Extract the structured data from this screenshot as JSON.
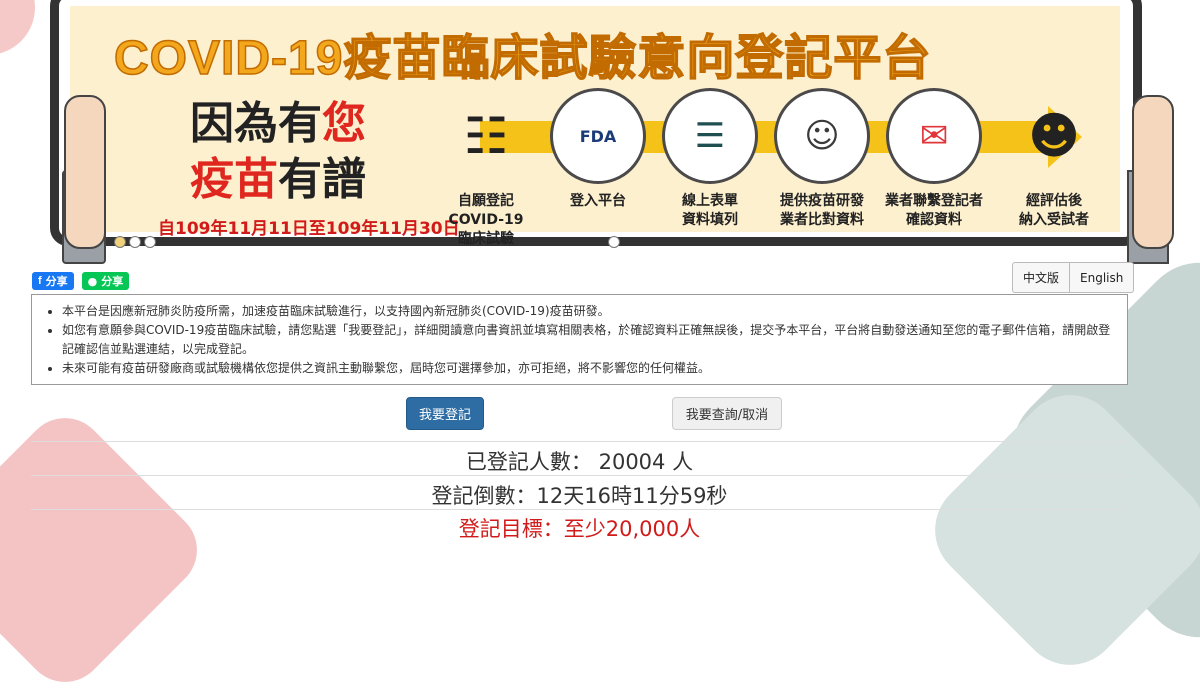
{
  "banner": {
    "title_latin": "COVID-19",
    "title_cjk": "疫苗臨床試驗意向登記平台",
    "tagline": {
      "line1_a": "因為有",
      "line1_b": "您",
      "line2_a": "疫苗",
      "line2_b": "有譜"
    },
    "dates": "自109年11月11日至109年11月30日",
    "steps": [
      {
        "label_1": "自願登記",
        "label_2": "COVID-19",
        "label_3": "臨床試驗",
        "icon": "people-icon"
      },
      {
        "label_1": "登入平台",
        "label_2": "",
        "label_3": "",
        "icon": "fda-logo-icon",
        "logo_text": "FDA"
      },
      {
        "label_1": "線上表單",
        "label_2": "資料填列",
        "label_3": "",
        "icon": "form-list-icon"
      },
      {
        "label_1": "提供疫苗研發",
        "label_2": "業者比對資料",
        "label_3": "",
        "icon": "doctor-icon"
      },
      {
        "label_1": "業者聯繫登記者",
        "label_2": "確認資料",
        "label_3": "",
        "icon": "mail-phone-icon"
      },
      {
        "label_1": "經評估後",
        "label_2": "納入受試者",
        "label_3": "",
        "icon": "selected-people-icon"
      }
    ]
  },
  "share": {
    "facebook_label": "分享",
    "line_label": "分享"
  },
  "language": {
    "zh": "中文版",
    "en": "English"
  },
  "info": {
    "items": [
      "本平台是因應新冠肺炎防疫所需，加速疫苗臨床試驗進行，以支持國內新冠肺炎(COVID-19)疫苗研發。",
      "如您有意願參與COVID-19疫苗臨床試驗，請您點選「我要登記」，詳細閱讀意向書資訊並填寫相關表格，於確認資料正確無誤後，提交予本平台，平台將自動發送通知至您的電子郵件信箱，請開啟登記確認信並點選連結，以完成登記。",
      "未來可能有疫苗研發廠商或試驗機構依您提供之資訊主動聯繫您，屆時您可選擇參加，亦可拒絕，將不影響您的任何權益。"
    ]
  },
  "actions": {
    "register": "我要登記",
    "query_cancel": "我要查詢/取消"
  },
  "stats": {
    "registered": "已登記人數： 20004 人",
    "countdown": "登記倒數：12天16時11分59秒",
    "target": "登記目標：至少20,000人"
  },
  "colors": {
    "primary_button": "#2e6da4",
    "target_red": "#d11a1a",
    "banner_bg": "#fdf0cf",
    "title_orange": "#f2a71c"
  }
}
